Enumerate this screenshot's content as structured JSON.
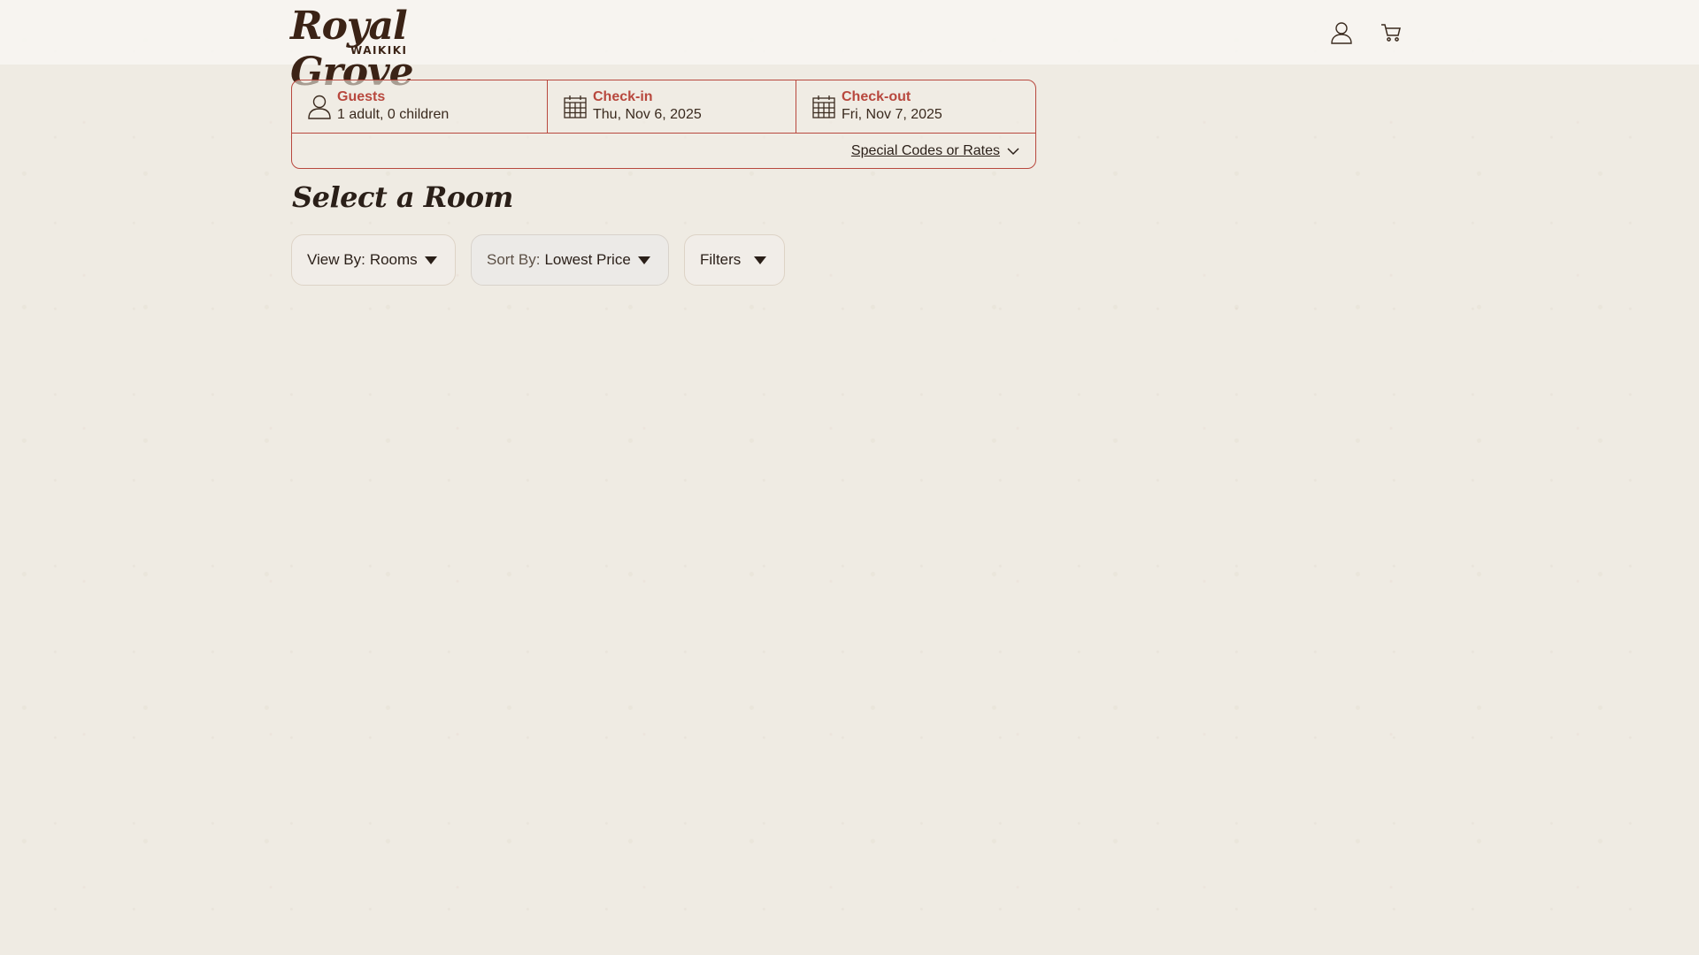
{
  "brand": {
    "name": "Royal Grove",
    "subtitle": "WAIKIKI"
  },
  "header": {
    "account_icon": "user-icon",
    "cart_icon": "cart-icon"
  },
  "booking": {
    "guests": {
      "label": "Guests",
      "value": "1 adult, 0 children",
      "icon": "user-icon"
    },
    "checkin": {
      "label": "Check-in",
      "value": "Thu, Nov 6, 2025",
      "icon": "calendar-icon"
    },
    "checkout": {
      "label": "Check-out",
      "value": "Fri, Nov 7, 2025",
      "icon": "calendar-icon"
    },
    "special_codes_label": "Special Codes or Rates"
  },
  "page": {
    "title": "Select a Room"
  },
  "controls": {
    "view_by": {
      "label": "View By:",
      "value": "Rooms"
    },
    "sort_by": {
      "label": "Sort By:",
      "value": "Lowest Price"
    },
    "filters": {
      "label": "Filters"
    }
  },
  "colors": {
    "accent": "#b8483e",
    "text": "#2a1f18",
    "background": "#efebe3"
  }
}
